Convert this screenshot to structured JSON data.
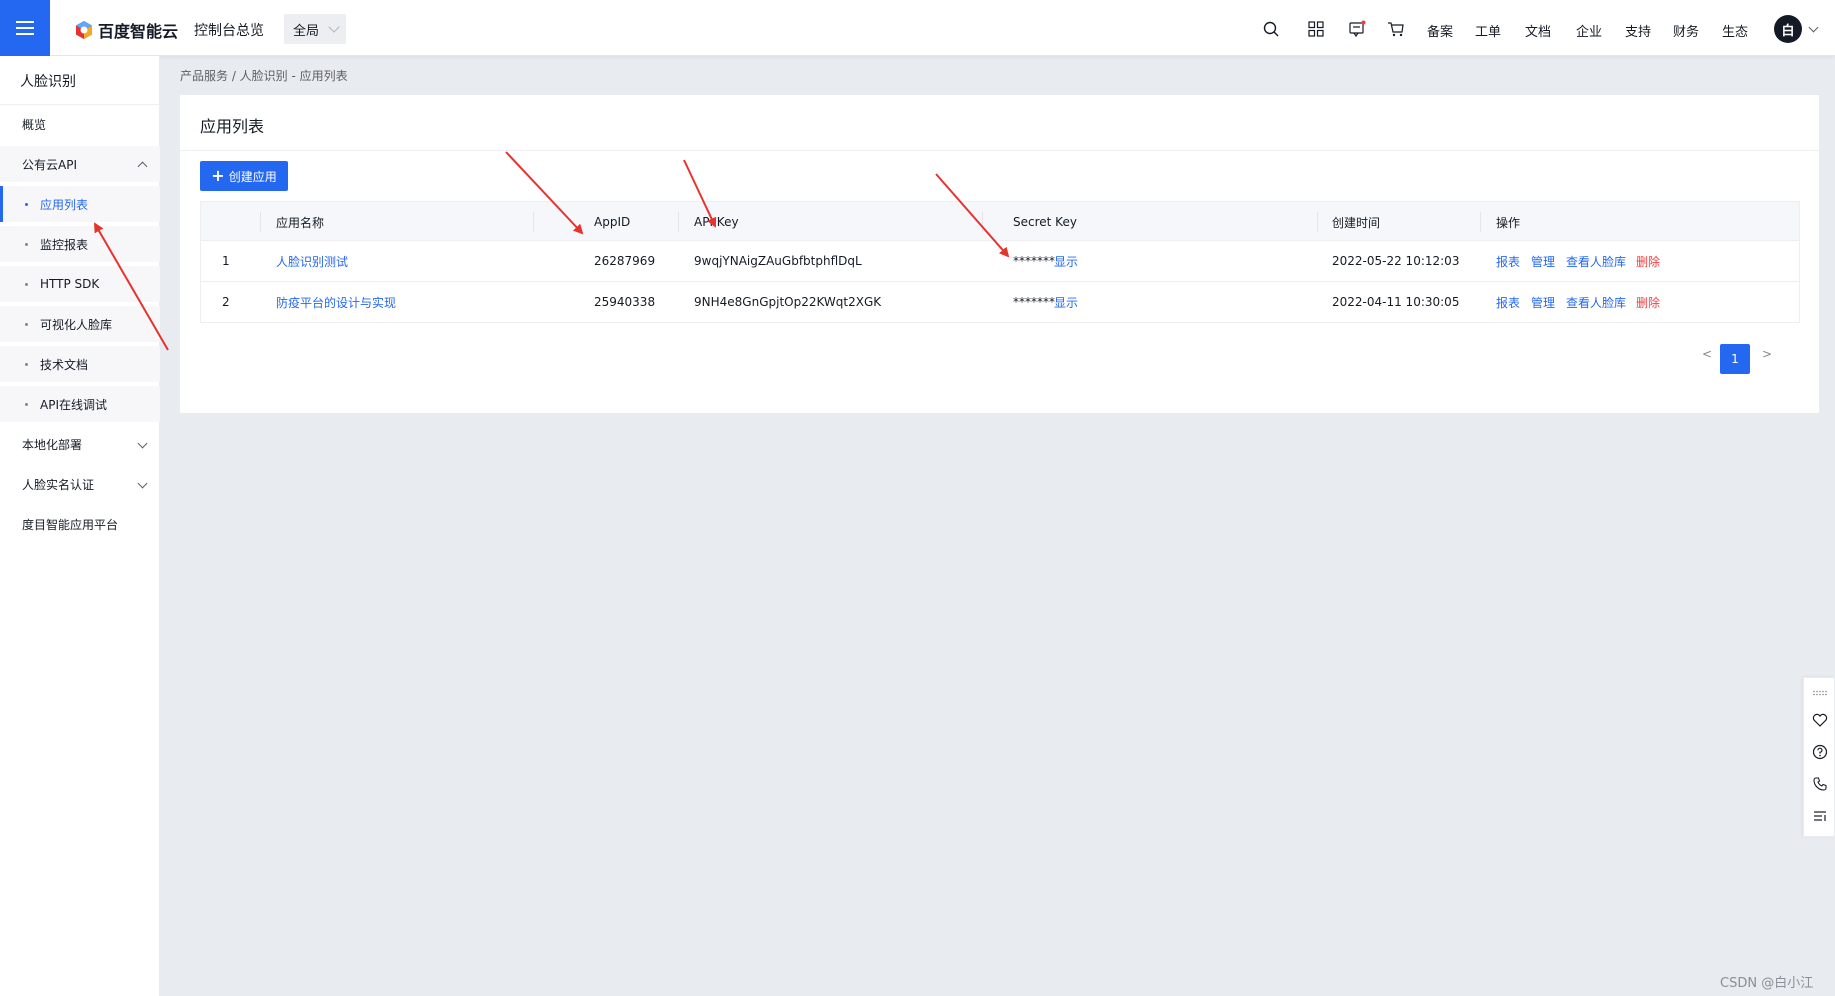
{
  "topbar": {
    "brand": "百度智能云",
    "console": "控制台总览",
    "region": "全局",
    "nav": [
      "备案",
      "工单",
      "文档",
      "企业",
      "支持",
      "财务",
      "生态"
    ],
    "avatar": "白"
  },
  "sidebar": {
    "title": "人脸识别",
    "items": [
      {
        "label": "概览"
      },
      {
        "label": "公有云API"
      },
      {
        "label": "应用列表"
      },
      {
        "label": "监控报表"
      },
      {
        "label": "HTTP SDK"
      },
      {
        "label": "可视化人脸库"
      },
      {
        "label": "技术文档"
      },
      {
        "label": "API在线调试"
      },
      {
        "label": "本地化部署"
      },
      {
        "label": "人脸实名认证"
      },
      {
        "label": "度目智能应用平台"
      }
    ]
  },
  "breadcrumb": "产品服务 / 人脸识别 - 应用列表",
  "card": {
    "title": "应用列表",
    "create_button": "创建应用"
  },
  "table": {
    "headers": [
      "",
      "应用名称",
      "AppID",
      "API Key",
      "Secret Key",
      "创建时间",
      "操作"
    ],
    "rows": [
      {
        "index": "1",
        "name": "人脸识别测试",
        "app_id": "26287969",
        "api_key": "9wqjYNAigZAuGbfbtphflDqL",
        "secret_mask": "*******",
        "secret_show": "显示",
        "created": "2022-05-22 10:12:03",
        "ops": [
          "报表",
          "管理",
          "查看人脸库",
          "删除"
        ]
      },
      {
        "index": "2",
        "name": "防疫平台的设计与实现",
        "app_id": "25940338",
        "api_key": "9NH4e8GnGpjtOp22KWqt2XGK",
        "secret_mask": "*******",
        "secret_show": "显示",
        "created": "2022-04-11 10:30:05",
        "ops": [
          "报表",
          "管理",
          "查看人脸库",
          "删除"
        ]
      }
    ]
  },
  "pagination": {
    "prev": "<",
    "current": "1",
    "next": ">"
  },
  "watermark": "CSDN @白小江",
  "colors": {
    "accent": "#2468f2",
    "danger": "#f33e3e",
    "annotation": "#e8322d"
  },
  "float_icons": [
    "grip-icon",
    "heart-icon",
    "help-icon",
    "phone-icon",
    "list-icon"
  ]
}
